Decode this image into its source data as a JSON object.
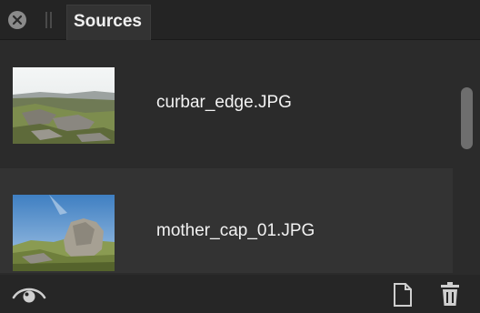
{
  "panel": {
    "tab_label": "Sources"
  },
  "sources": [
    {
      "filename": "curbar_edge.JPG",
      "selected": false
    },
    {
      "filename": "mother_cap_01.JPG",
      "selected": true
    }
  ],
  "toolbar": {
    "eye_icon": "eye-icon",
    "new_icon": "new-document-icon",
    "delete_icon": "trash-icon"
  },
  "colors": {
    "background": "#2b2b2b",
    "selected_row": "#333333",
    "titlebar": "#242424"
  }
}
